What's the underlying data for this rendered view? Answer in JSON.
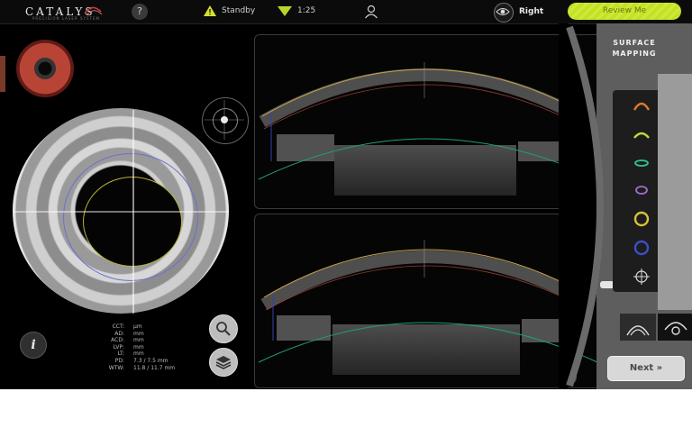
{
  "topbar": {
    "brand": "CATALYS",
    "brand_sub": "PRECISION LASER SYSTEM",
    "help_label": "?",
    "status_label": "Standby",
    "ratio_label": "1:25",
    "eye_label": "Right",
    "review_label": "Review Me"
  },
  "left": {
    "info_label": "i",
    "metrics": [
      {
        "label": "CCT:",
        "value": "μm"
      },
      {
        "label": "AD:",
        "value": "mm"
      },
      {
        "label": "ACD:",
        "value": "mm"
      },
      {
        "label": "LVP:",
        "value": "mm"
      },
      {
        "label": "LT:",
        "value": "mm"
      },
      {
        "label": "PD:",
        "value": "7.3 / 7.5 mm"
      },
      {
        "label": "WTW:",
        "value": "11.8 / 11.7 mm"
      }
    ]
  },
  "right": {
    "title_line1": "SURFACE",
    "title_line2": "MAPPING",
    "tools": [
      {
        "name": "anterior-capsule-tool",
        "color": "#e07a2e"
      },
      {
        "name": "posterior-capsule-tool",
        "color": "#c6d63a"
      },
      {
        "name": "capsulotomy-tool",
        "color": "#2ec49a"
      },
      {
        "name": "lens-fragment-tool",
        "color": "#9d6fd0"
      },
      {
        "name": "iris-ring-tool",
        "color": "#d9c23a"
      },
      {
        "name": "limbus-ring-tool",
        "color": "#3b4fc9"
      },
      {
        "name": "crosshair-tool",
        "color": "#dddddd"
      }
    ],
    "next_label": "Next »"
  },
  "colors": {
    "accent": "#c5e21c",
    "cornea_anterior": "#c7a24a",
    "lens_curve": "#1f9e7a",
    "iris_guide": "#6c6fd3"
  }
}
